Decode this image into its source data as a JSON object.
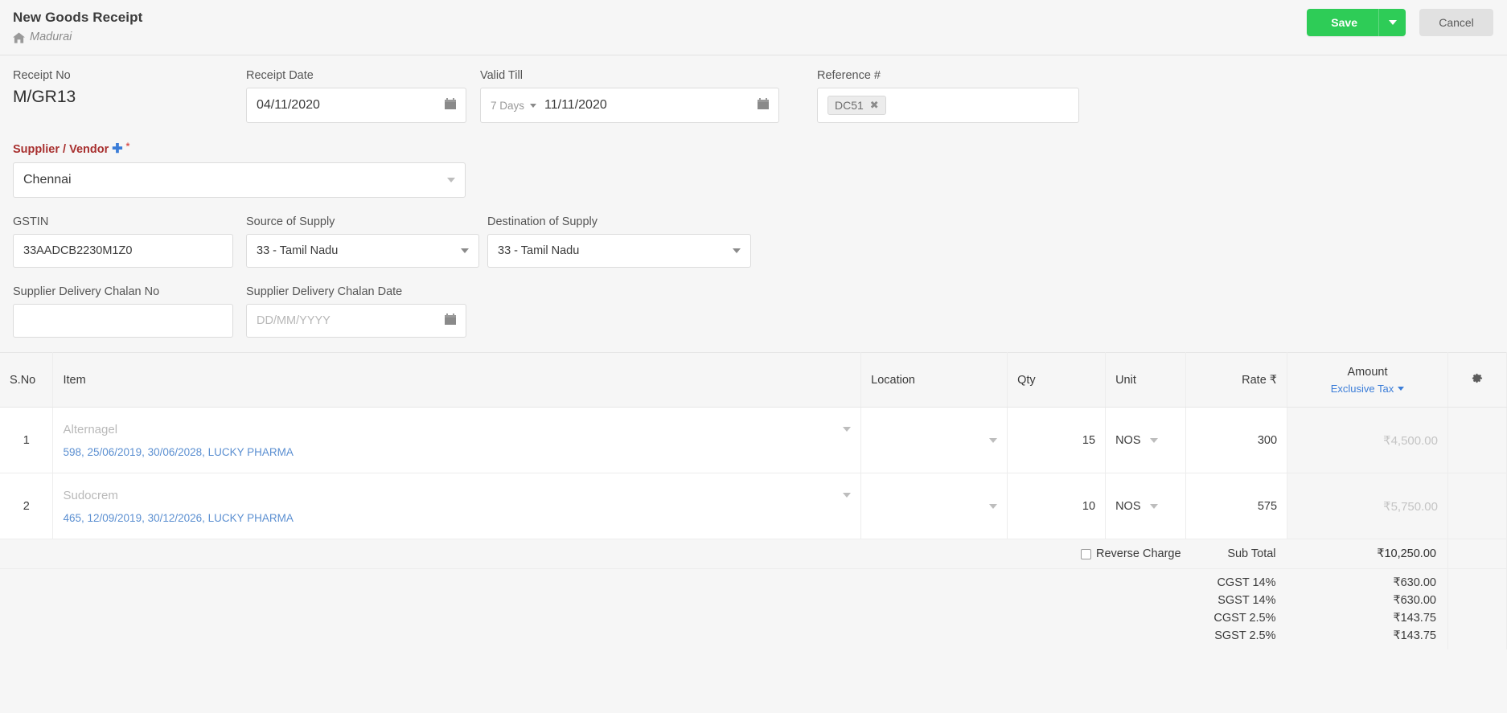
{
  "header": {
    "title": "New Goods Receipt",
    "breadcrumb": "Madurai",
    "home_icon": "home-icon",
    "save_label": "Save",
    "cancel_label": "Cancel",
    "accent_green": "#2ecc57",
    "cancel_bg": "#e1e1e1"
  },
  "form": {
    "receipt_no_label": "Receipt No",
    "receipt_no_value": "M/GR13",
    "receipt_date_label": "Receipt Date",
    "receipt_date_value": "04/11/2020",
    "valid_till_label": "Valid Till",
    "valid_till_term": "7 Days",
    "valid_till_value": "11/11/2020",
    "reference_label": "Reference #",
    "reference_tag": "DC51",
    "reference_tag_remove": "✖",
    "supplier_label": "Supplier / Vendor",
    "supplier_plus": "✚",
    "supplier_required": "*",
    "supplier_value": "Chennai",
    "gstin_label": "GSTIN",
    "gstin_value": "33AADCB2230M1Z0",
    "source_label": "Source of Supply",
    "source_value": "33 - Tamil Nadu",
    "destination_label": "Destination of Supply",
    "destination_value": "33 - Tamil Nadu",
    "chalan_no_label": "Supplier Delivery Chalan No",
    "chalan_no_value": "",
    "chalan_date_label": "Supplier Delivery Chalan Date",
    "chalan_date_placeholder": "DD/MM/YYYY",
    "calendar_icon": "calendar-icon"
  },
  "table": {
    "columns": {
      "sno": "S.No",
      "item": "Item",
      "location": "Location",
      "qty": "Qty",
      "unit": "Unit",
      "rate": "Rate ₹",
      "amount": "Amount",
      "amount_sub": "Exclusive Tax",
      "settings_icon": "gear-icon"
    },
    "rows": [
      {
        "sno": "1",
        "item": "Alternagel",
        "meta": "598, 25/06/2019, 30/06/2028, LUCKY PHARMA",
        "location": "",
        "qty": "15",
        "unit": "NOS",
        "rate": "300",
        "amount": "₹4,500.00"
      },
      {
        "sno": "2",
        "item": "Sudocrem",
        "meta": "465, 12/09/2019, 30/12/2026, LUCKY PHARMA",
        "location": "",
        "qty": "10",
        "unit": "NOS",
        "rate": "575",
        "amount": "₹5,750.00"
      }
    ]
  },
  "totals": {
    "reverse_charge_label": "Reverse Charge",
    "reverse_charge_checked": false,
    "sub_total_label": "Sub Total",
    "sub_total_value": "₹10,250.00",
    "taxes": [
      {
        "label": "CGST 14%",
        "value": "₹630.00"
      },
      {
        "label": "SGST 14%",
        "value": "₹630.00"
      },
      {
        "label": "CGST 2.5%",
        "value": "₹143.75"
      },
      {
        "label": "SGST 2.5%",
        "value": "₹143.75"
      }
    ]
  }
}
